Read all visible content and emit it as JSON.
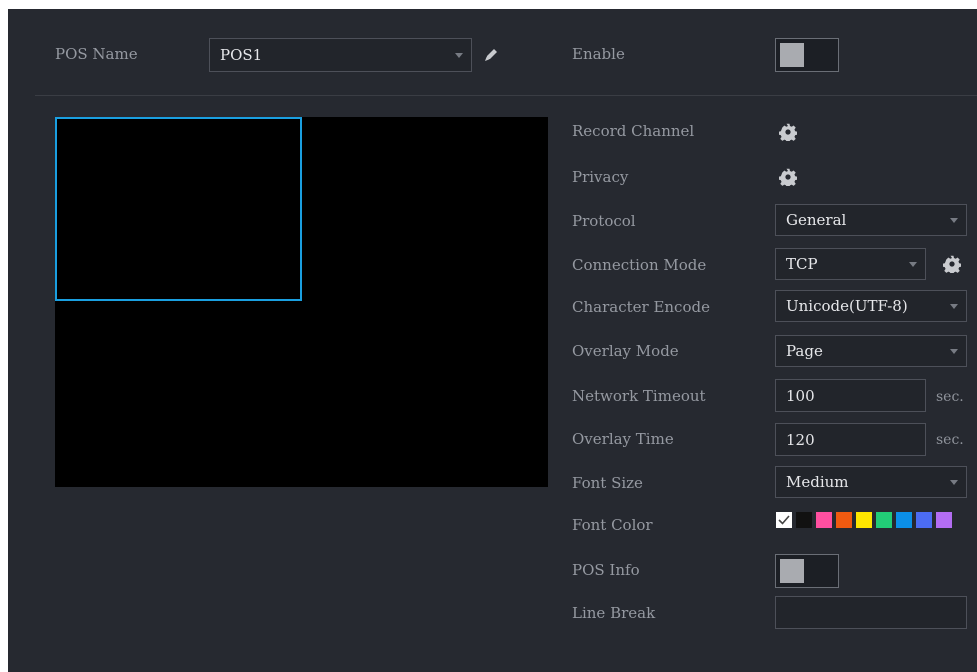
{
  "pos_name": {
    "label": "POS Name",
    "value": "POS1"
  },
  "enable": {
    "label": "Enable",
    "on": false
  },
  "settings": {
    "record_channel": "Record Channel",
    "privacy": "Privacy",
    "protocol": {
      "label": "Protocol",
      "value": "General"
    },
    "connection_mode": {
      "label": "Connection Mode",
      "value": "TCP"
    },
    "character_encode": {
      "label": "Character Encode",
      "value": "Unicode(UTF-8)"
    },
    "overlay_mode": {
      "label": "Overlay Mode",
      "value": "Page"
    },
    "network_timeout": {
      "label": "Network Timeout",
      "value": "100",
      "unit": "sec."
    },
    "overlay_time": {
      "label": "Overlay Time",
      "value": "120",
      "unit": "sec."
    },
    "font_size": {
      "label": "Font Size",
      "value": "Medium"
    },
    "font_color": {
      "label": "Font Color",
      "selected": "white",
      "colors": [
        "#ffffff",
        "#111111",
        "#ff4fa0",
        "#f05a10",
        "#ffe600",
        "#22cc77",
        "#0b8fe8",
        "#4c6cf2",
        "#b36df2"
      ]
    },
    "pos_info": {
      "label": "POS Info",
      "on": false
    },
    "line_break": {
      "label": "Line Break",
      "value": ""
    }
  },
  "colors": {
    "panel": "#262930",
    "preview": "#000000",
    "overlay_rect": "#1a9fe0"
  },
  "icons": [
    "edit-icon",
    "gear-icon",
    "dropdown-caret"
  ]
}
